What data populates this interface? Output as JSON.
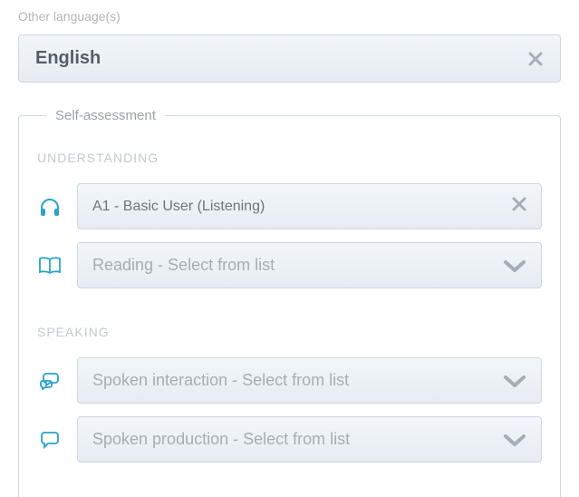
{
  "section_label": "Other language(s)",
  "language_bar": {
    "title": "English"
  },
  "fieldset_legend": "Self-assessment",
  "categories": {
    "understanding": {
      "label": "UNDERSTANDING",
      "listening_value": "A1 - Basic User (Listening)",
      "reading_placeholder": "Reading - Select from list"
    },
    "speaking": {
      "label": "SPEAKING",
      "interaction_placeholder": "Spoken interaction - Select from list",
      "production_placeholder": "Spoken production - Select from list"
    }
  }
}
